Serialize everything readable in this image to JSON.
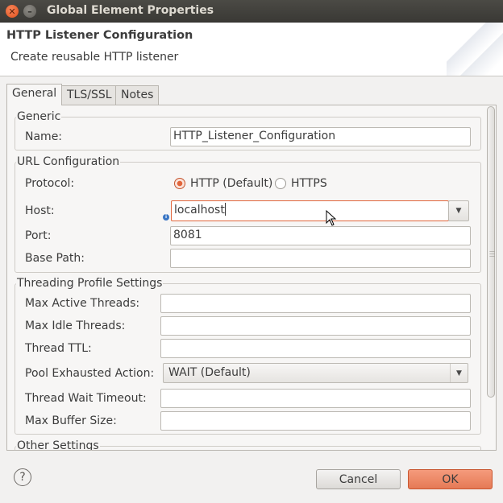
{
  "window": {
    "title": "Global Element Properties"
  },
  "header": {
    "title": "HTTP Listener Configuration",
    "subtitle": "Create reusable HTTP listener"
  },
  "tabs": [
    {
      "label": "General",
      "active": true
    },
    {
      "label": "TLS/SSL",
      "active": false
    },
    {
      "label": "Notes",
      "active": false
    }
  ],
  "generic": {
    "title": "Generic",
    "name_label": "Name:",
    "name_value": "HTTP_Listener_Configuration"
  },
  "url": {
    "title": "URL Configuration",
    "protocol_label": "Protocol:",
    "protocol_options": [
      "HTTP (Default)",
      "HTTPS"
    ],
    "protocol_selected": "HTTP (Default)",
    "host_label": "Host:",
    "host_value": "localhost",
    "port_label": "Port:",
    "port_value": "8081",
    "base_path_label": "Base Path:",
    "base_path_value": ""
  },
  "threading": {
    "title": "Threading Profile Settings",
    "max_active_label": "Max Active Threads:",
    "max_idle_label": "Max Idle Threads:",
    "ttl_label": "Thread TTL:",
    "pool_exhausted_label": "Pool Exhausted Action:",
    "pool_exhausted_value": "WAIT (Default)",
    "wait_timeout_label": "Thread Wait Timeout:",
    "max_buffer_label": "Max Buffer Size:"
  },
  "other": {
    "title": "Other Settings"
  },
  "buttons": {
    "help": "?",
    "cancel": "Cancel",
    "ok": "OK"
  },
  "icons": {
    "close": "close-icon",
    "minimize": "minimize-icon",
    "info": "info-icon",
    "cursor": "mouse-cursor-icon"
  },
  "colors": {
    "accent": "#e1653b",
    "ok_button": "#ec8a69",
    "titlebar": "#3f3e3a"
  }
}
